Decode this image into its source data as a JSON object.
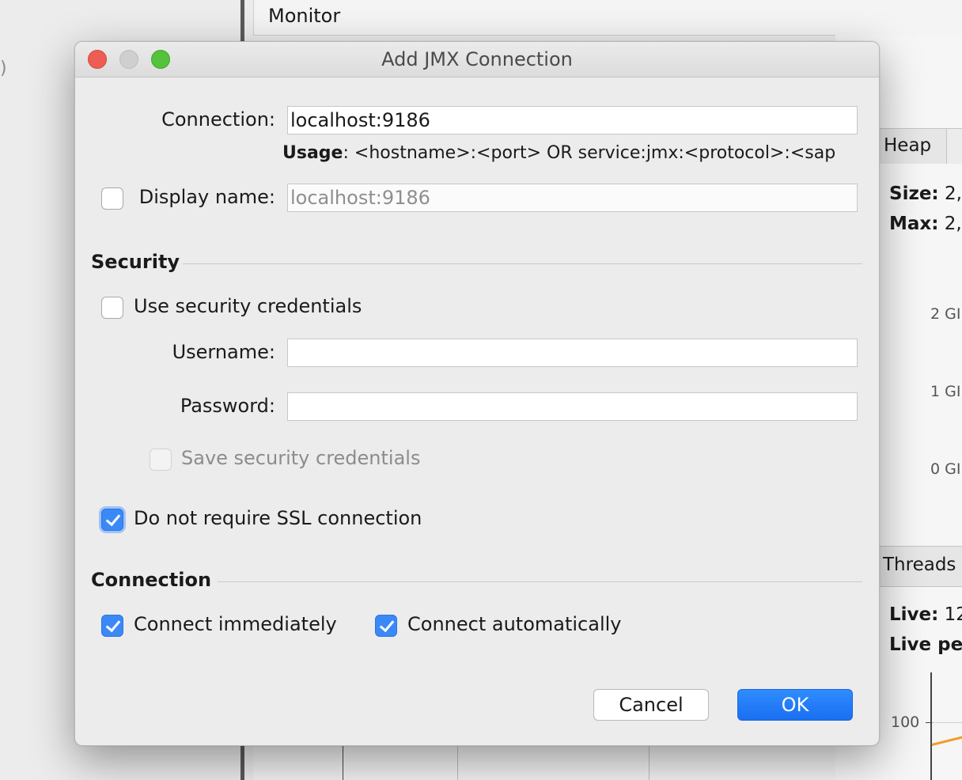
{
  "background": {
    "left_fragment": ")",
    "monitor_tab": "Monitor",
    "heap_tab": "Heap",
    "size_label": "Size:",
    "size_value": "2,",
    "max_label": "Max:",
    "max_value": "2,",
    "ticks": [
      "2 GI",
      "1 GI",
      "0 GI"
    ],
    "threads_tab": "Threads",
    "live_label": "Live:",
    "live_value": "12",
    "live_peak": "Live pe",
    "chart_tick": "100",
    "chart_line_color": "#f39c2b"
  },
  "dialog": {
    "title": "Add JMX Connection",
    "connection_label": "Connection:",
    "connection_value": "localhost:9186",
    "usage_label": "Usage",
    "usage_text": ": <hostname>:<port> OR service:jmx:<protocol>:<sap",
    "display_name_checked": false,
    "display_name_label": "Display name:",
    "display_name_value": "localhost:9186",
    "security_section": "Security",
    "use_credentials_checked": false,
    "use_credentials_label": "Use security credentials",
    "username_label": "Username:",
    "username_value": "",
    "password_label": "Password:",
    "password_value": "",
    "save_credentials_checked": false,
    "save_credentials_label": "Save security credentials",
    "no_ssl_checked": true,
    "no_ssl_label": "Do not require SSL connection",
    "connection_section": "Connection",
    "connect_immediately_checked": true,
    "connect_immediately_label": "Connect immediately",
    "connect_automatically_checked": true,
    "connect_automatically_label": "Connect automatically",
    "cancel_label": "Cancel",
    "ok_label": "OK",
    "accent_color": "#3b88f7"
  }
}
